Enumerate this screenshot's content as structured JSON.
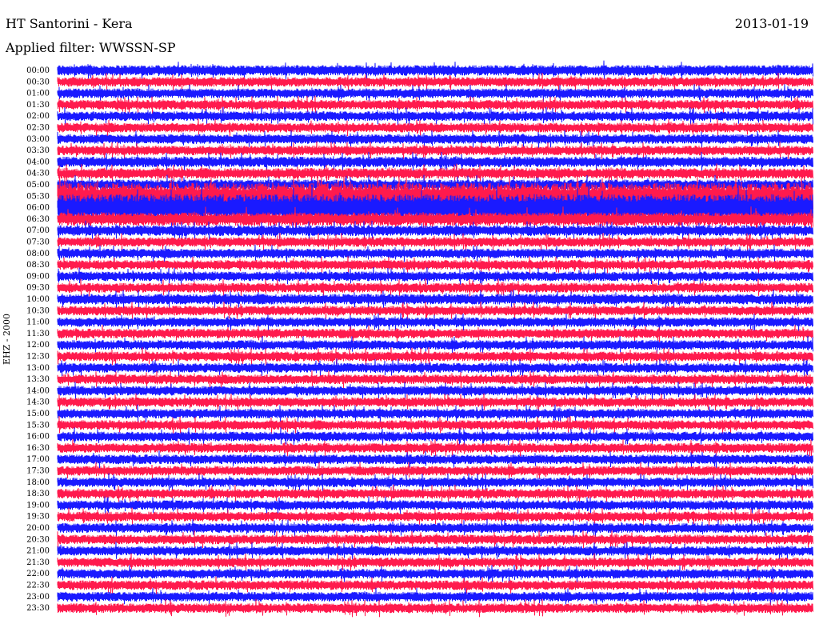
{
  "header": {
    "station": "HT Santorini - Kera",
    "date": "2013-01-19",
    "filter": "Applied filter: WWSSN-SP"
  },
  "side_label": "EHZ - 2000",
  "colors": {
    "series_a": "#1a1aff",
    "series_b": "#ff1a4d",
    "background": "#ffffff"
  },
  "chart_data": {
    "type": "line",
    "title": "HT Santorini - Kera",
    "subtitle": "Applied filter: WWSSN-SP",
    "ylabel": "EHZ - 2000",
    "xlabel": "",
    "row_labels": [
      "00:00",
      "00:30",
      "01:00",
      "01:30",
      "02:00",
      "02:30",
      "03:00",
      "03:30",
      "04:00",
      "04:30",
      "05:00",
      "05:30",
      "06:00",
      "06:30",
      "07:00",
      "07:30",
      "08:00",
      "08:30",
      "09:00",
      "09:30",
      "10:00",
      "10:30",
      "11:00",
      "11:30",
      "12:00",
      "12:30",
      "13:00",
      "13:30",
      "14:00",
      "14:30",
      "15:00",
      "15:30",
      "16:00",
      "16:30",
      "17:00",
      "17:30",
      "18:00",
      "18:30",
      "19:00",
      "19:30",
      "20:00",
      "20:30",
      "21:00",
      "21:30",
      "22:00",
      "22:30",
      "23:00",
      "23:30"
    ],
    "row_colors": [
      "series_a",
      "series_b",
      "series_a",
      "series_b",
      "series_a",
      "series_b",
      "series_a",
      "series_b",
      "series_a",
      "series_b",
      "series_a",
      "series_b",
      "series_a",
      "series_b",
      "series_a",
      "series_b",
      "series_a",
      "series_b",
      "series_a",
      "series_b",
      "series_a",
      "series_b",
      "series_a",
      "series_b",
      "series_a",
      "series_b",
      "series_a",
      "series_b",
      "series_a",
      "series_b",
      "series_a",
      "series_b",
      "series_a",
      "series_b",
      "series_a",
      "series_b",
      "series_a",
      "series_b",
      "series_a",
      "series_b",
      "series_a",
      "series_b",
      "series_a",
      "series_b",
      "series_a",
      "series_b",
      "series_a",
      "series_b"
    ],
    "relative_amplitude": [
      1.1,
      1.0,
      1.0,
      1.0,
      1.0,
      1.0,
      1.0,
      1.0,
      1.1,
      1.1,
      1.1,
      2.8,
      2.8,
      1.4,
      1.1,
      1.0,
      1.0,
      1.0,
      1.0,
      1.0,
      1.1,
      1.0,
      1.0,
      1.0,
      1.0,
      1.0,
      1.0,
      1.0,
      1.0,
      1.0,
      1.0,
      1.0,
      1.0,
      1.0,
      1.0,
      1.0,
      1.0,
      1.0,
      1.0,
      1.0,
      1.0,
      1.0,
      1.0,
      1.0,
      1.0,
      1.0,
      1.0,
      1.0
    ],
    "grid": false,
    "legend": "none"
  }
}
